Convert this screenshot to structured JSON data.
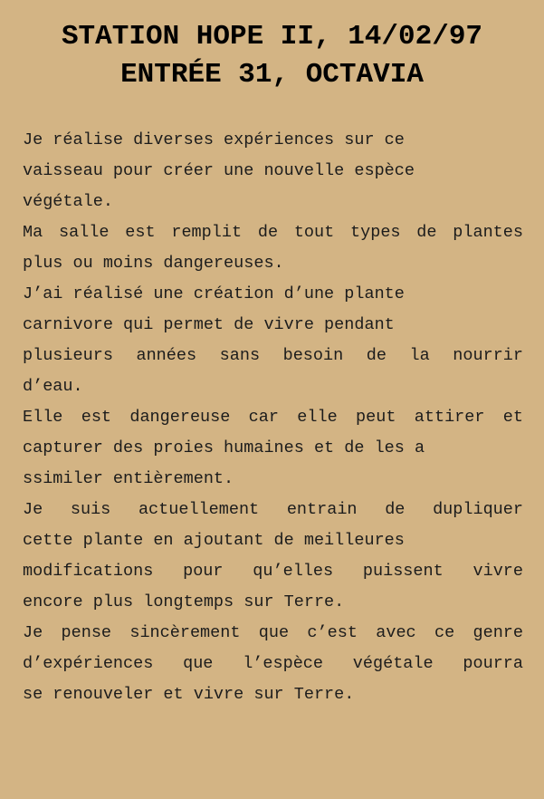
{
  "document": {
    "title_line1": "STATION HOPE II, 14/02/97",
    "title_line2": "ENTRÉE 31, OCTAVIA",
    "lines": [
      "Je réalise diverses expériences sur ce",
      "vaisseau pour créer une nouvelle espèce",
      "végétale.",
      "Ma salle est remplit de tout types de plantes",
      "plus ou moins dangereuses.",
      "J’ai réalisé une création d’une plante",
      "carnivore qui permet de vivre pendant",
      "plusieurs années sans besoin de la nourrir",
      "d’eau.",
      "Elle est dangereuse car elle peut attirer et",
      "capturer des proies humaines et de les a",
      "ssimiler entièrement.",
      "Je suis actuellement entrain de dupliquer",
      "cette plante en ajoutant de meilleures",
      "modifications pour qu’elles puissent vivre",
      "encore plus longtemps sur Terre.",
      "Je pense sincèrement que c’est avec ce genre",
      "d’expériences que l’espèce végétale pourra",
      "se renouveler et vivre sur Terre."
    ]
  }
}
